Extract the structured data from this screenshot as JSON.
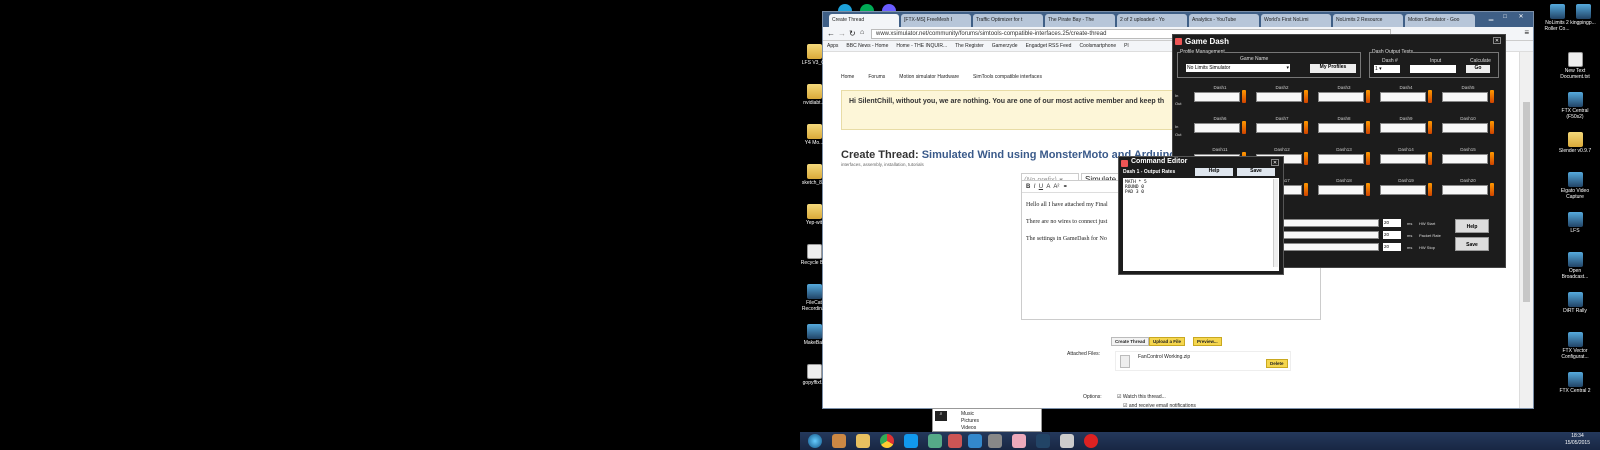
{
  "desktop_left": [
    {
      "label": "LFS V3_CI",
      "type": "folder"
    },
    {
      "label": "nvidiabt...",
      "type": "folder"
    },
    {
      "label": "Y4 Mo...",
      "type": "folder"
    },
    {
      "label": "sketch_8...",
      "type": "folder"
    },
    {
      "label": "Yep-wit",
      "type": "folder"
    },
    {
      "label": "Recycle Bin",
      "type": "bin"
    },
    {
      "label": "FileCat Recordin...",
      "type": "app"
    },
    {
      "label": "MakeBall",
      "type": "app"
    },
    {
      "label": "gopyffixf...",
      "type": "file"
    }
  ],
  "desktop_right": [
    {
      "label": "New Text Document.txt",
      "type": "file"
    },
    {
      "label": "FTX Central (F50s2)",
      "type": "app"
    },
    {
      "label": "Slender v0.9.7",
      "type": "folder"
    },
    {
      "label": "Elgato Video Capture",
      "type": "app"
    },
    {
      "label": "LFS",
      "type": "app"
    },
    {
      "label": "Open Broadcast...",
      "type": "app"
    },
    {
      "label": "DiRT Rally",
      "type": "app"
    },
    {
      "label": "FTX Vector Configurat...",
      "type": "app"
    },
    {
      "label": "FTX Central 2",
      "type": "app"
    }
  ],
  "topright_icons": [
    "kingpingp...",
    "NoLimits 2 Roller Co..."
  ],
  "browser": {
    "tabs": [
      "Create Thread",
      "[FTX-MS] FreeMesh I",
      "Traffic Optimizer for t",
      "The Pirate Bay - The",
      "2 of 2 uploaded - Yo",
      "Analytics - YouTube",
      "World's First NoLimi",
      "NoLimits 2 Resource",
      "Motion Simulator - Goo"
    ],
    "url": "www.xsimulator.net/community/forums/simtools-compatible-interfaces.25/create-thread",
    "bookmarks": [
      "Apps",
      "BBC News - Home",
      "Home - THE INQUIR...",
      "The Register",
      "Gamerzyde",
      "Engadget RSS Feed",
      "Coolsmartphone",
      "Pl"
    ],
    "breadcrumbs": [
      "Home",
      "Forums",
      "Motion simulator Hardware",
      "SimTools compatible interfaces"
    ],
    "notice": "Hi SilentChill, without you, we are nothing. You are one of our most active member and keep th",
    "create_label": "Create Thread:",
    "thread_title": "Simulated Wind using MonsterMoto and ArduinoUno",
    "subtitle": "interfaces, assembly, installation, tutorials",
    "prefix": "(No prefix)",
    "title_field": "Simulate",
    "body_lines": [
      "Hello all I have attached my Final",
      "There are no wires to connect just",
      "The settings in GameDash for No"
    ],
    "btn_create": "Create Thread",
    "btn_upload": "Upload a File",
    "btn_preview": "Preview...",
    "attached_label": "Attached Files:",
    "attached_file": "FanControl Working.zip",
    "delete": "Delete",
    "options_label": "Options:",
    "opt1": "Watch this thread...",
    "opt2": "and receive email notifications"
  },
  "gamedash": {
    "title": "Game Dash",
    "profile_group": "Profile Management",
    "game_name_label": "Game Name",
    "game_name": "No Limits Simulator",
    "my_profiles": "My Profiles",
    "test_group": "Dash Output Tests",
    "dash_num_label": "Dash #",
    "input_label": "Input",
    "calculate_label": "Calculate",
    "dash_num": "1",
    "go": "Go",
    "in_label": "In",
    "out_label": "Out",
    "dashes": [
      "Dash1",
      "Dash2",
      "Dash3",
      "Dash4",
      "Dash5",
      "Dash6",
      "Dash7",
      "Dash8",
      "Dash9",
      "Dash10",
      "Dash11",
      "Dash12",
      "Dash13",
      "Dash14",
      "Dash15",
      "Dash16",
      "Dash17",
      "Dash18",
      "Dash19",
      "Dash20"
    ],
    "hw_start": "HW Start",
    "packet_rate": "Packet Rate",
    "hw_stop": "HW Stop",
    "ms": "ms",
    "val": "20",
    "help": "Help",
    "save": "Save"
  },
  "cmd_editor": {
    "title": "Command Editor",
    "sub": "Dash 1 - Output Rates",
    "help": "Help",
    "save": "Save",
    "code": [
      "MATH * 5",
      "ROUND 0",
      "PAD 3 0"
    ]
  },
  "taskbar": {
    "time": "18:34",
    "date": "15/05/2015",
    "explorer": [
      "Music",
      "Pictures",
      "Videos"
    ]
  }
}
